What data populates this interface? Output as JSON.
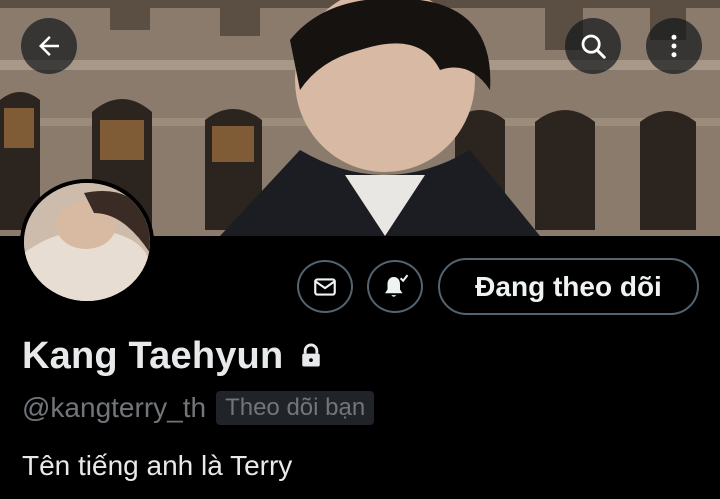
{
  "header": {
    "back_icon": "arrow-left-icon",
    "search_icon": "search-icon",
    "more_icon": "more-vertical-icon"
  },
  "profile": {
    "display_name": "Kang Taehyun",
    "handle": "@kangterry_th",
    "follows_you_label": "Theo dõi bạn",
    "bio": "Tên tiếng anh là Terry",
    "protected_icon": "lock-icon"
  },
  "actions": {
    "message_icon": "mail-icon",
    "notifications_icon": "bell-subscribed-icon",
    "follow_label": "Đang theo dõi"
  },
  "colors": {
    "background": "#000000",
    "text_primary": "#e7e9ea",
    "text_secondary": "#71767b",
    "button_border": "#536471"
  }
}
